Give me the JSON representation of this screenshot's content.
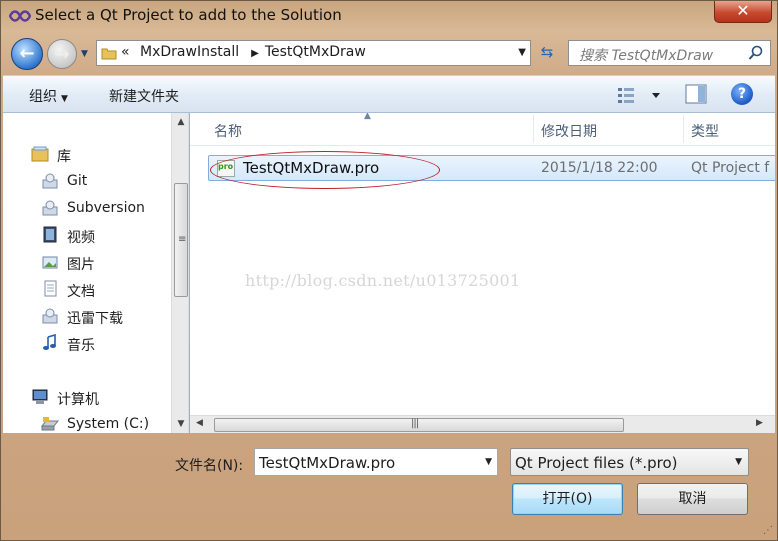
{
  "window": {
    "title": "Select a Qt Project to add to the Solution",
    "close_label": "✕"
  },
  "nav": {
    "breadcrumb_prefix": "«",
    "breadcrumbs": [
      "MxDrawInstall",
      "TestQtMxDraw"
    ],
    "search_placeholder": "搜索 TestQtMxDraw"
  },
  "toolbar": {
    "organize_label": "组织",
    "new_folder_label": "新建文件夹"
  },
  "sidebar": {
    "items": [
      {
        "label": "库",
        "icon": "library-icon"
      },
      {
        "label": "Git",
        "icon": "git-library-icon"
      },
      {
        "label": "Subversion",
        "icon": "subversion-library-icon"
      },
      {
        "label": "视频",
        "icon": "videos-icon"
      },
      {
        "label": "图片",
        "icon": "pictures-icon"
      },
      {
        "label": "文档",
        "icon": "documents-icon"
      },
      {
        "label": "迅雷下载",
        "icon": "downloads-library-icon"
      },
      {
        "label": "音乐",
        "icon": "music-icon"
      },
      {
        "label": "计算机",
        "icon": "computer-icon"
      },
      {
        "label": "System (C:)",
        "icon": "drive-icon"
      }
    ]
  },
  "file_list": {
    "columns": [
      "名称",
      "修改日期",
      "类型"
    ],
    "rows": [
      {
        "name": "TestQtMxDraw.pro",
        "modified": "2015/1/18 22:00",
        "type": "Qt Project f",
        "icon_text": "pro"
      }
    ],
    "watermark": "http://blog.csdn.net/u013725001"
  },
  "footer": {
    "filename_label": "文件名(N):",
    "filename_value": "TestQtMxDraw.pro",
    "filetype_value": "Qt Project files (*.pro)",
    "open_label": "打开(O)",
    "cancel_label": "取消"
  },
  "colors": {
    "selection_fill": "#d5e8fb",
    "selection_border": "#84acdd",
    "annotation_ellipse": "#c0202a",
    "accent": "#2f77d0"
  }
}
